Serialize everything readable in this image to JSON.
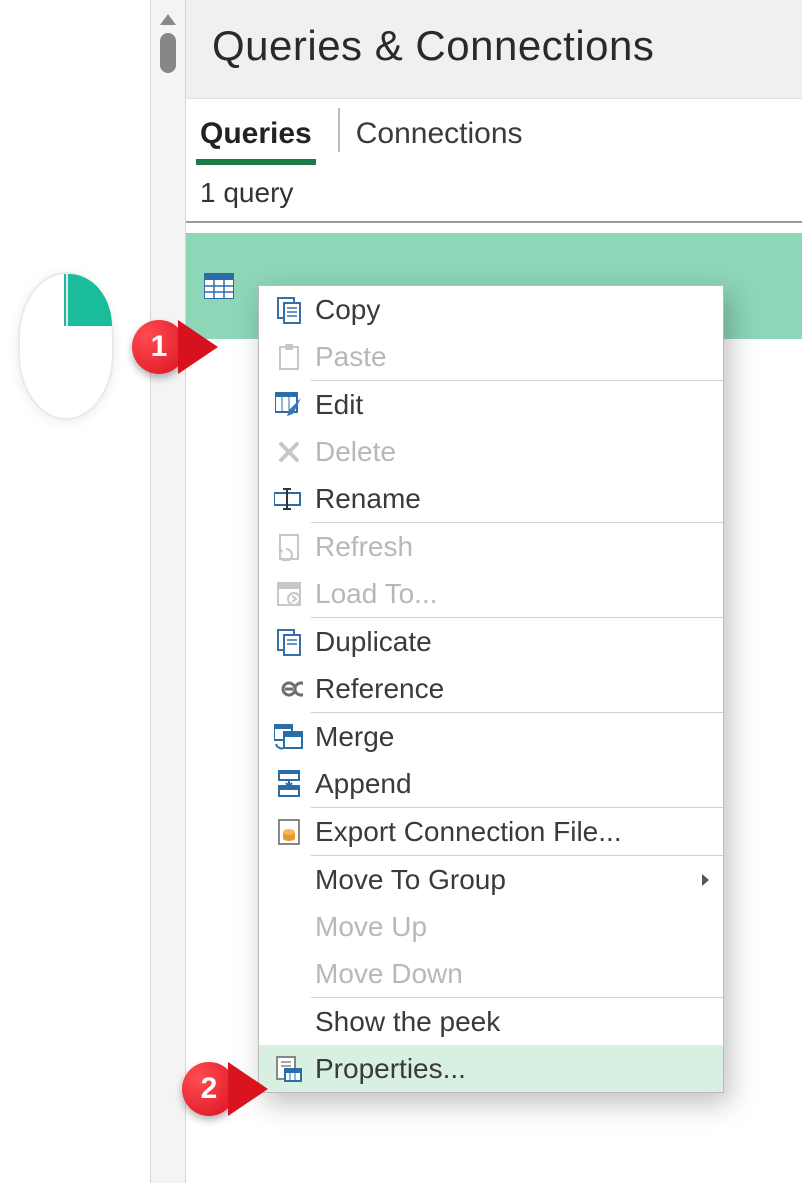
{
  "panel": {
    "title": "Queries & Connections",
    "tabs": {
      "queries": "Queries",
      "connections": "Connections"
    },
    "status": "1 query"
  },
  "context_menu": {
    "copy": "Copy",
    "paste": "Paste",
    "edit": "Edit",
    "delete": "Delete",
    "rename": "Rename",
    "refresh": "Refresh",
    "load_to": "Load To...",
    "duplicate": "Duplicate",
    "reference": "Reference",
    "merge": "Merge",
    "append": "Append",
    "export_conn": "Export Connection File...",
    "move_group": "Move To Group",
    "move_up": "Move Up",
    "move_down": "Move Down",
    "show_peek": "Show the peek",
    "properties": "Properties..."
  },
  "callouts": {
    "c1": "1",
    "c2": "2"
  }
}
